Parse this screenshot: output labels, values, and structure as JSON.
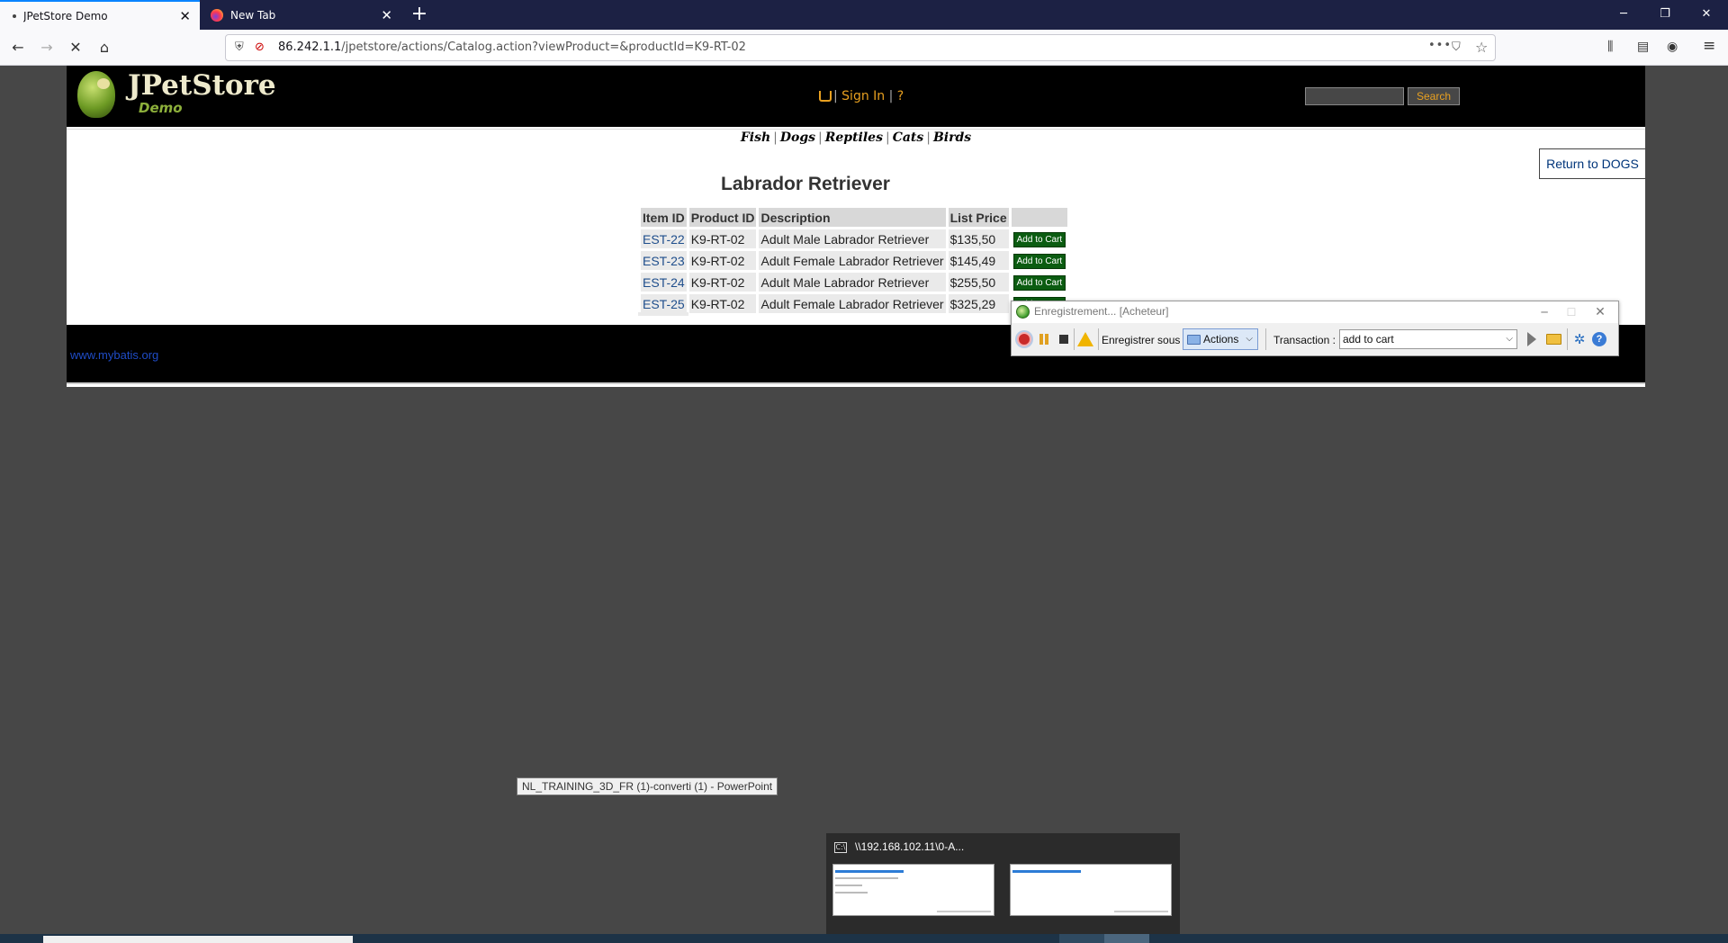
{
  "browser": {
    "tabs": [
      {
        "label": "JPetStore Demo",
        "active": true
      },
      {
        "label": "New Tab",
        "active": false
      }
    ],
    "url_host": "86.242.1.1",
    "url_path": "/jpetstore/actions/Catalog.action?viewProduct=&productId=K9-RT-02",
    "window_controls": {
      "minimize": "─",
      "restore": "❐",
      "close": "✕"
    },
    "icons": {
      "back": "←",
      "forward": "→",
      "reload": "✕",
      "home": "⌂",
      "more": "•••",
      "pocket": "⛉",
      "star": "☆",
      "library": "⫼",
      "sidebar": "▤",
      "account": "◉",
      "menu": "≡",
      "new_tab": "+",
      "tab_close": "✕"
    }
  },
  "store": {
    "logo_title": "JPetStore",
    "logo_subtitle": "Demo",
    "sign_in": "Sign In",
    "help": "?",
    "search_button": "Search",
    "categories": [
      "Fish",
      "Dogs",
      "Reptiles",
      "Cats",
      "Birds"
    ],
    "return_link": "Return to DOGS",
    "product_title": "Labrador Retriever",
    "table": {
      "headers": [
        "Item ID",
        "Product ID",
        "Description",
        "List Price"
      ],
      "rows": [
        {
          "item_id": "EST-22",
          "product_id": "K9-RT-02",
          "description": "Adult Male Labrador Retriever",
          "price": "$135,50",
          "button": "Add to Cart"
        },
        {
          "item_id": "EST-23",
          "product_id": "K9-RT-02",
          "description": "Adult Female Labrador Retriever",
          "price": "$145,49",
          "button": "Add to Cart"
        },
        {
          "item_id": "EST-24",
          "product_id": "K9-RT-02",
          "description": "Adult Male Labrador Retriever",
          "price": "$255,50",
          "button": "Add to Cart"
        },
        {
          "item_id": "EST-25",
          "product_id": "K9-RT-02",
          "description": "Adult Female Labrador Retriever",
          "price": "$325,29",
          "button": "Add to Cart"
        }
      ]
    },
    "footer_link": "www.mybatis.org"
  },
  "recorder": {
    "title": "Enregistrement... [Acheteur]",
    "save_as_label": "Enregistrer sous :",
    "folder_value": "Actions",
    "transaction_label": "Transaction :",
    "transaction_value": "add to cart",
    "help_glyph": "?",
    "settings_glyph": "✲",
    "chevron": "⌵",
    "window_controls": {
      "minimize": "─",
      "maximize": "☐",
      "close": "✕"
    }
  },
  "taskbar": {
    "tooltip": "NL_TRAINING_3D_FR (1)-converti (1) - PowerPoint",
    "preview_title": "\\\\192.168.102.11\\0-A...",
    "preview_icon": "C:\\"
  }
}
